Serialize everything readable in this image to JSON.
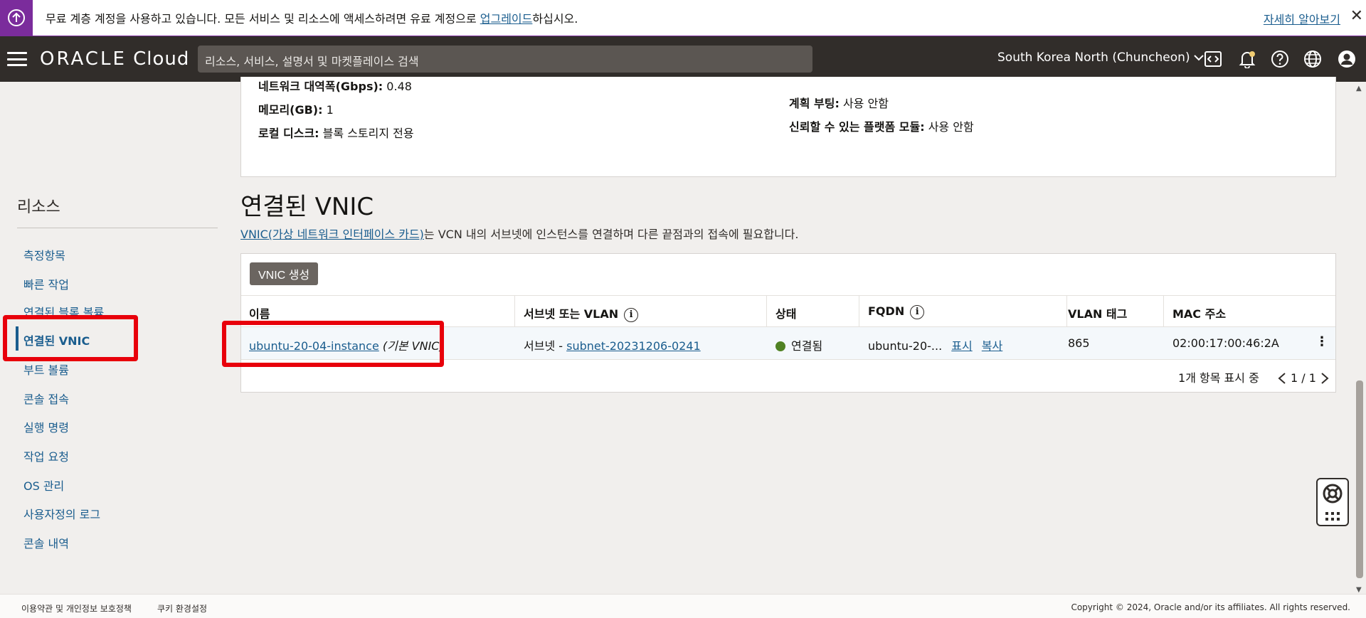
{
  "banner": {
    "text_before": "무료 계층 계정을 사용하고 있습니다. 모든 서비스 및 리소스에 액세스하려면 유료 계정으로 ",
    "upgrade_link": "업그레이드",
    "text_after": "하십시오.",
    "learn_more": "자세히 알아보기",
    "close": "✕"
  },
  "header": {
    "logo_oracle": "ORACLE",
    "logo_cloud": "Cloud",
    "search_placeholder": "리소스, 서비스, 설명서 및 마켓플레이스 검색",
    "region": "South Korea North (Chuncheon)"
  },
  "details": {
    "network_label": "네트워크 대역폭(Gbps):",
    "network_value": "0.48",
    "memory_label": "메모리(GB):",
    "memory_value": "1",
    "local_disk_label": "로컬 디스크:",
    "local_disk_value": "블록 스토리지 전용",
    "measured_boot_label": "계획 부팅:",
    "measured_boot_value": "사용 안함",
    "tpm_label": "신뢰할 수 있는 플랫폼 모듈:",
    "tpm_value": "사용 안함"
  },
  "sidebar": {
    "title": "리소스",
    "items": [
      {
        "label": "측정항목"
      },
      {
        "label": "빠른 작업"
      },
      {
        "label": "연결된 블록 볼륨"
      },
      {
        "label": "연결된 VNIC"
      },
      {
        "label": "부트 볼륨"
      },
      {
        "label": "콘솔 접속"
      },
      {
        "label": "실행 명령"
      },
      {
        "label": "작업 요청"
      },
      {
        "label": "OS 관리"
      },
      {
        "label": "사용자정의 로그"
      },
      {
        "label": "콘솔 내역"
      }
    ]
  },
  "main": {
    "heading": "연결된 VNIC",
    "desc_link": "VNIC(가상 네트워크 인터페이스 카드)",
    "desc_rest": "는 VCN 내의 서브넷에 인스턴스를 연결하며 다른 끝점과의 접속에 필요합니다.",
    "create_button": "VNIC 생성",
    "columns": [
      "이름",
      "서브넷 또는 VLAN",
      "상태",
      "FQDN",
      "VLAN 태그",
      "MAC 주소"
    ],
    "row": {
      "name": "ubuntu-20-04-instance",
      "name_suffix": "(기본 VNIC)",
      "subnet_prefix": "서브넷 - ",
      "subnet_link": "subnet-20231206-0241",
      "status": "연결됨",
      "fqdn": "ubuntu-20-...",
      "fqdn_show": "표시",
      "fqdn_copy": "복사",
      "vlan_tag": "865",
      "mac": "02:00:17:00:46:2A"
    },
    "pager_text": "1개 항목 표시 중",
    "pager_pages": "1 / 1"
  },
  "footer": {
    "terms": "이용약관 및 개인정보 보호정책",
    "cookies": "쿠키 환경설정",
    "copyright": "Copyright © 2024, Oracle and/or its affiliates. All rights reserved."
  },
  "colors": {
    "header_bg": "#312d2a",
    "link": "#1a5d8e",
    "highlight": "#e8000b",
    "banner_accent": "#7b2c9c",
    "status_green": "#508223"
  }
}
